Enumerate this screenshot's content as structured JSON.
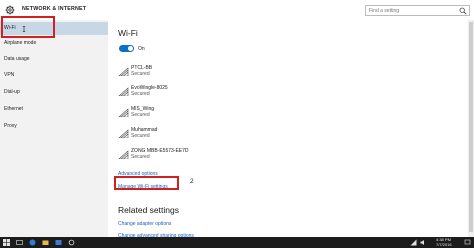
{
  "app": {
    "title": "NETWORK & INTERNET"
  },
  "search": {
    "placeholder": "Find a setting"
  },
  "sidebar": {
    "items": [
      {
        "label": "Wi-Fi",
        "active": true
      },
      {
        "label": "Airplane mode"
      },
      {
        "label": "Data usage"
      },
      {
        "label": "VPN"
      },
      {
        "label": "Dial-up"
      },
      {
        "label": "Ethernet"
      },
      {
        "label": "Proxy"
      }
    ]
  },
  "annotations": {
    "step2": "2"
  },
  "main": {
    "title": "Wi-Fi",
    "toggle_label": "On",
    "toggle_on": true,
    "networks": [
      {
        "ssid": "PTCL-BB",
        "status": "Secured"
      },
      {
        "ssid": "EvoWingle-8025",
        "status": "Secured"
      },
      {
        "ssid": "MIS_Wing",
        "status": "Secured"
      },
      {
        "ssid": "Muhammad",
        "status": "Secured"
      },
      {
        "ssid": "ZONG MBB-E5573-EE7D",
        "status": "Secured"
      }
    ],
    "advanced_options": "Advanced options",
    "manage_wifi": "Manage Wi-Fi settings",
    "related_title": "Related settings",
    "related_links": [
      "Change adapter options",
      "Change advanced sharing options"
    ]
  },
  "taskbar": {
    "time": "4:38 PM",
    "date": "7/7/2016"
  },
  "colors": {
    "accent": "#0f6fc6",
    "link": "#1f5fbf",
    "highlight": "#d21f1f",
    "active_nav": "#c7d7e6"
  }
}
